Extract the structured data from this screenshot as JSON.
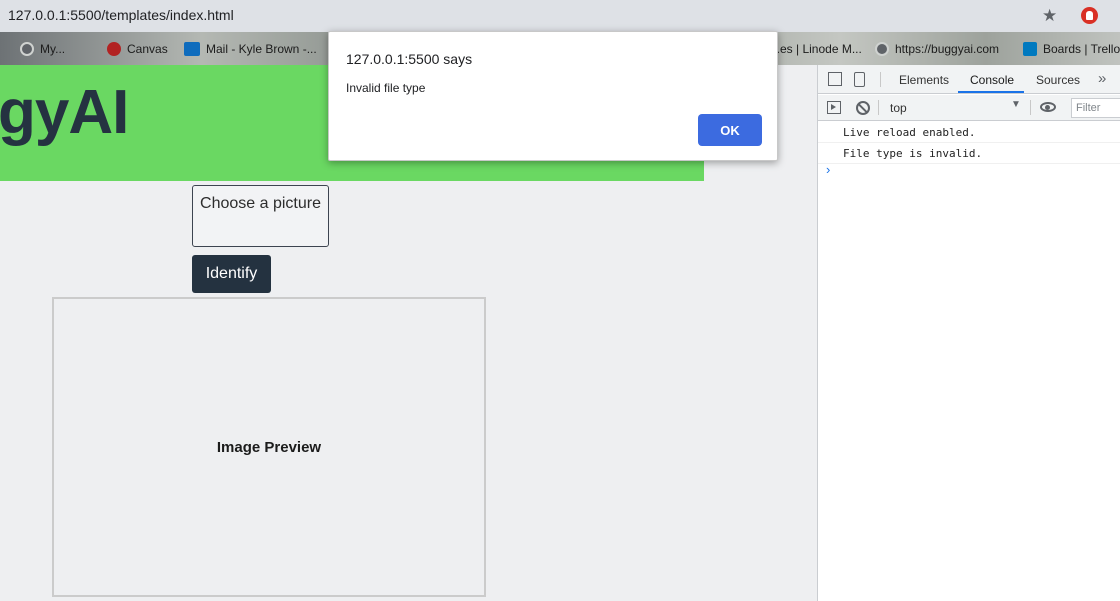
{
  "browser": {
    "url": "127.0.0.1:5500/templates/index.html",
    "star_icon": "★",
    "extension_icon": "adblock-icon"
  },
  "bookmarks": [
    {
      "label": "My...",
      "icon": "globe-icon"
    },
    {
      "label": "Canvas",
      "icon": "canvas-icon"
    },
    {
      "label": "Mail - Kyle Brown -...",
      "icon": "outlook-icon"
    },
    {
      "label": "...es | Linode M...",
      "icon": "none"
    },
    {
      "label": "https://buggyai.com",
      "icon": "globe-icon"
    },
    {
      "label": "Boards | Trello",
      "icon": "trello-icon"
    }
  ],
  "page": {
    "logo_text": "gyAI",
    "choose_label": "Choose a picture",
    "identify_label": "Identify",
    "preview_label": "Image Preview",
    "hero_color": "#6ad862"
  },
  "dialog": {
    "title": "127.0.0.1:5500 says",
    "message": "Invalid file type",
    "ok_label": "OK"
  },
  "devtools": {
    "tabs": [
      "Elements",
      "Console",
      "Sources"
    ],
    "active_tab": "Console",
    "more": "»",
    "context": "top",
    "filter_placeholder": "Filter",
    "console_lines": [
      "Live reload enabled.",
      "File type is invalid."
    ],
    "prompt": "›"
  }
}
